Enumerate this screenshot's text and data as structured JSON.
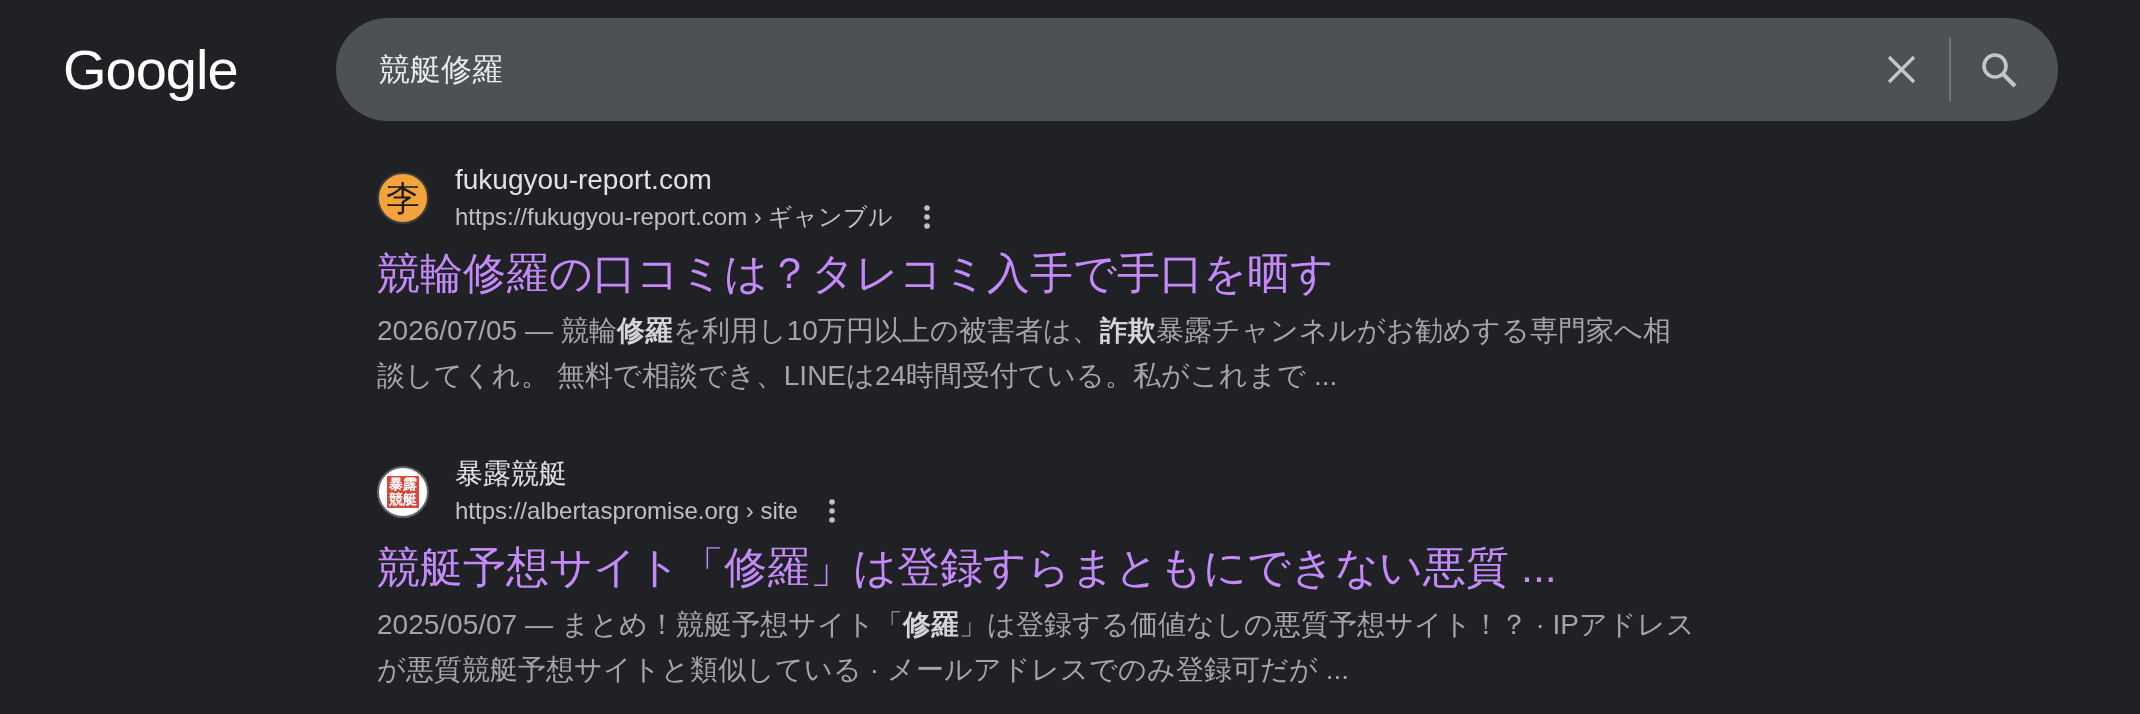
{
  "header": {
    "logo": "Google",
    "search": {
      "query": "競艇修羅"
    }
  },
  "results": [
    {
      "favicon": {
        "kind": "letter",
        "text": "李"
      },
      "site_name": "fukugyou-report.com",
      "url": "https://fukugyou-report.com › ギャンブル",
      "title": "競輪修羅の口コミは？タレコミ入手で手口を晒す",
      "snippet": "2026/07/05 — 競輪**修羅**を利用し10万円以上の被害者は、**詐欺**暴露チャンネルがお勧めする専門家へ相談してくれ。 無料で相談でき、LINEは24時間受付ている。私がこれまで ..."
    },
    {
      "favicon": {
        "kind": "stamp",
        "text": "暴露競艇"
      },
      "site_name": "暴露競艇",
      "url": "https://albertaspromise.org › site",
      "title": "競艇予想サイト「修羅」は登録すらまともにできない悪質 ...",
      "snippet": "2025/05/07 — まとめ！競艇予想サイト「**修羅**」は登録する価値なしの悪質予想サイト！？ · IPアドレスが悪質競艇予想サイトと類似している · メールアドレスでのみ登録可だが ..."
    }
  ]
}
